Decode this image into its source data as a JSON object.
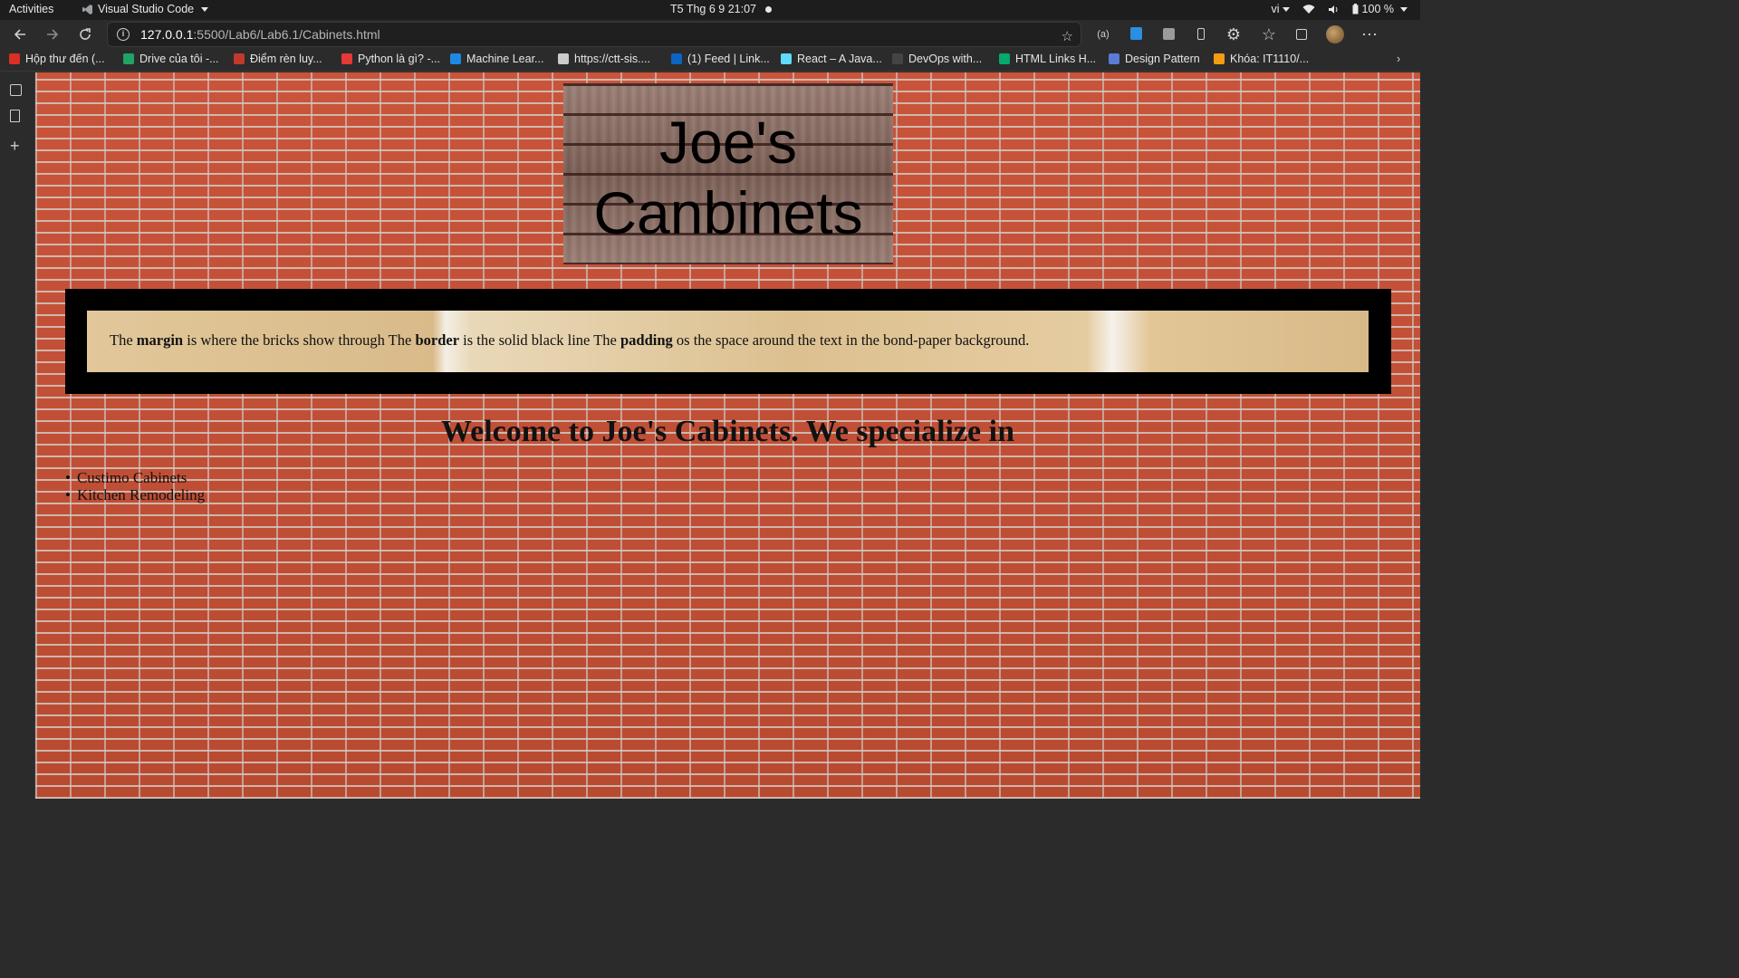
{
  "system_bar": {
    "activities": "Activities",
    "app_name": "Visual Studio Code",
    "clock": "T5 Thg 6 9  21:07",
    "language": "vi",
    "battery": "100 %"
  },
  "browser": {
    "url_host": "127.0.0.1",
    "url_path": ":5500/Lab6/Lab6.1/Cabinets.html"
  },
  "bookmarks": [
    {
      "label": "Hộp thư đến (...",
      "color": "#d93025"
    },
    {
      "label": "Drive của tôi -...",
      "color": "#1fa463"
    },
    {
      "label": "Điểm rèn luy...",
      "color": "#c0392b"
    },
    {
      "label": "Python là gì? -...",
      "color": "#e53935"
    },
    {
      "label": "Machine Lear...",
      "color": "#1e88e5"
    },
    {
      "label": "https://ctt-sis....",
      "color": "#cccccc"
    },
    {
      "label": "(1) Feed | Link...",
      "color": "#0a66c2"
    },
    {
      "label": "React – A Java...",
      "color": "#61dafb"
    },
    {
      "label": "DevOps with...",
      "color": "#444444"
    },
    {
      "label": "HTML Links H...",
      "color": "#04aa6d"
    },
    {
      "label": "Design Pattern",
      "color": "#5b7bd5"
    },
    {
      "label": "Khóa: IT1110/...",
      "color": "#f39c12"
    }
  ],
  "page": {
    "logo_line1": "Joe's",
    "logo_line2": "Canbinets",
    "intro": {
      "p1": "The ",
      "b1": "margin",
      "p2": " is where the bricks show through The ",
      "b2": "border",
      "p3": " is the solid black line The ",
      "b3": "padding",
      "p4": " os the space around the text in the bond-paper background."
    },
    "welcome": "Welcome to Joe's Cabinets. We specialize in",
    "services": [
      "Custimo Cabinets",
      "Kitchen Remodeling"
    ]
  }
}
